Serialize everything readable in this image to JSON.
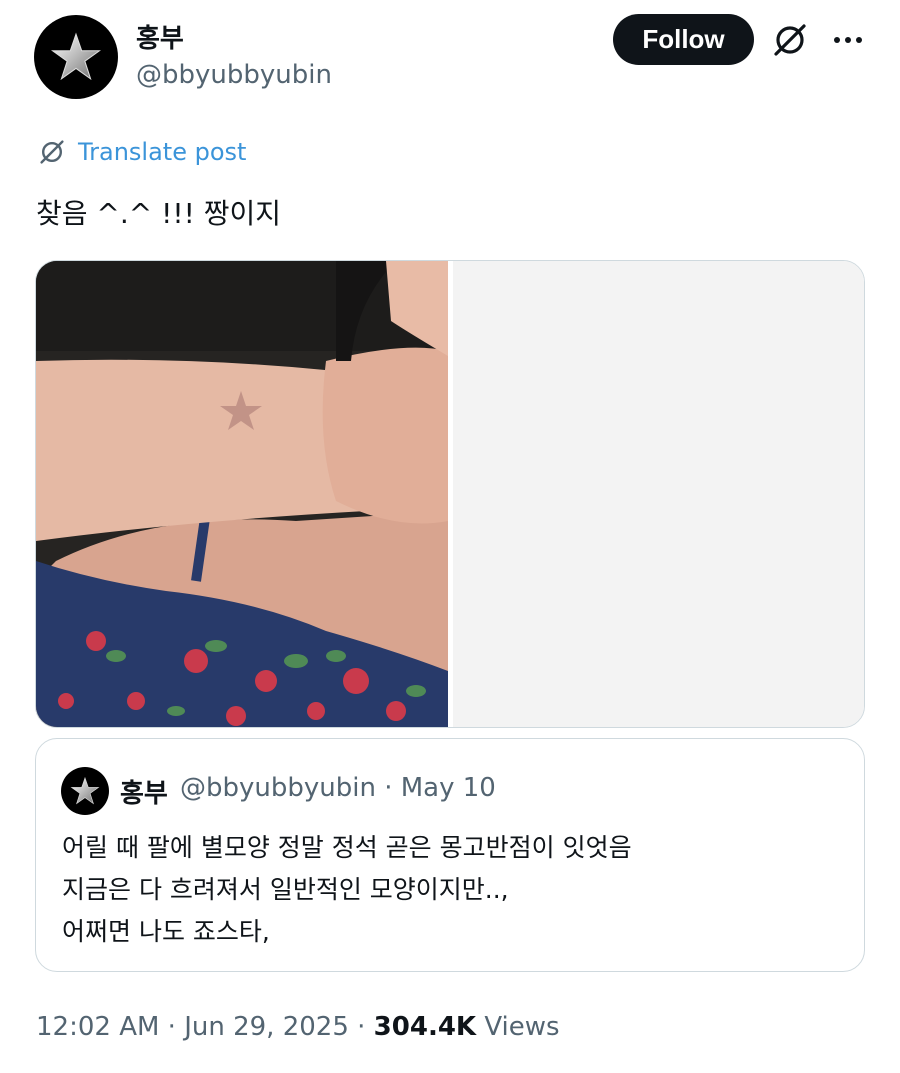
{
  "author": {
    "display_name": "홍부",
    "handle": "@bbyubbyubin",
    "avatar_icon": "star-icon"
  },
  "header_actions": {
    "follow_label": "Follow",
    "grok_icon": "grok-icon",
    "more_icon": "more-icon"
  },
  "translate": {
    "label": "Translate post",
    "icon": "grok-icon"
  },
  "post": {
    "text": "찾음 ^.^ !!! 짱이지"
  },
  "media": {
    "items": [
      "photo",
      "placeholder"
    ]
  },
  "quote": {
    "display_name": "홍부",
    "handle_date": "@bbyubbyubin · May 10",
    "lines": [
      "어릴 때 팔에 별모양 정말 정석 곧은 몽고반점이 잇엇음",
      "지금은 다 흐려져서 일반적인 모양이지만..,",
      "어쩌면 나도 죠스타,"
    ]
  },
  "meta": {
    "time_date": "12:02 AM · Jun 29, 2025 · ",
    "views_count": "304.4K",
    "views_label": " Views"
  },
  "colors": {
    "accent": "#1d9bf0",
    "text": "#0f1419",
    "secondary": "#536471",
    "border": "#cfd9de"
  }
}
